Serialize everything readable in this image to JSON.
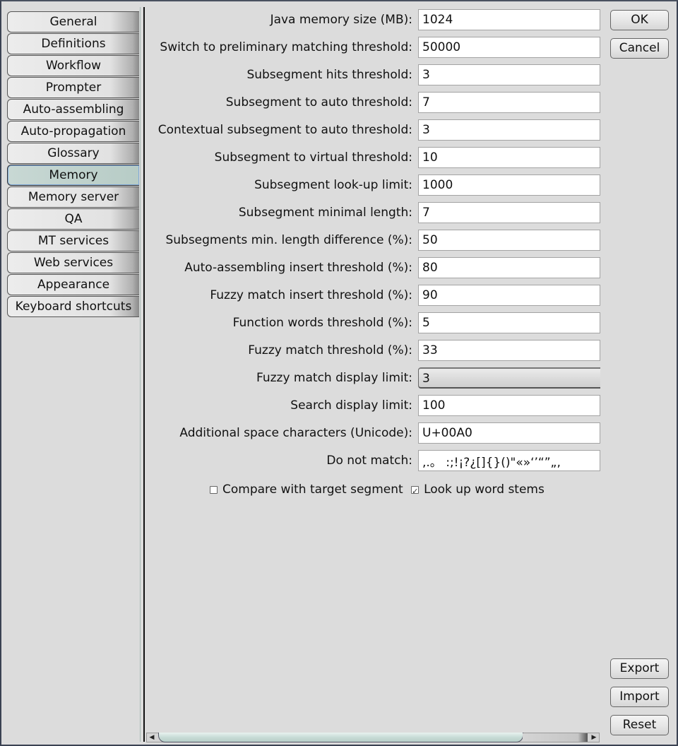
{
  "sidebar": {
    "items": [
      {
        "label": "General"
      },
      {
        "label": "Definitions"
      },
      {
        "label": "Workflow"
      },
      {
        "label": "Prompter"
      },
      {
        "label": "Auto-assembling"
      },
      {
        "label": "Auto-propagation"
      },
      {
        "label": "Glossary"
      },
      {
        "label": "Memory",
        "active": true
      },
      {
        "label": "Memory server"
      },
      {
        "label": "QA"
      },
      {
        "label": "MT services"
      },
      {
        "label": "Web services"
      },
      {
        "label": "Appearance"
      },
      {
        "label": "Keyboard shortcuts"
      }
    ],
    "selected": "Memory"
  },
  "form": {
    "fields": [
      {
        "label": "Java memory size (MB):",
        "value": "1024"
      },
      {
        "label": "Switch to preliminary matching threshold:",
        "value": "50000"
      },
      {
        "label": "Subsegment hits threshold:",
        "value": "3"
      },
      {
        "label": "Subsegment to auto threshold:",
        "value": "7"
      },
      {
        "label": "Contextual subsegment to auto threshold:",
        "value": "3"
      },
      {
        "label": "Subsegment to virtual threshold:",
        "value": "10"
      },
      {
        "label": "Subsegment look-up limit:",
        "value": "1000"
      },
      {
        "label": "Subsegment minimal length:",
        "value": "7"
      },
      {
        "label": "Subsegments min. length difference (%):",
        "value": "50"
      },
      {
        "label": "Auto-assembling insert threshold (%):",
        "value": "80"
      },
      {
        "label": "Fuzzy match insert threshold (%):",
        "value": "90"
      },
      {
        "label": "Function words threshold (%):",
        "value": "5"
      },
      {
        "label": "Fuzzy match threshold (%):",
        "value": "33"
      },
      {
        "label": "Fuzzy match display limit:",
        "value": "3",
        "type": "spinner"
      },
      {
        "label": "Search display limit:",
        "value": "100"
      },
      {
        "label": "Additional space characters (Unicode):",
        "value": "U+00A0"
      },
      {
        "label": "Do not match:",
        "value": ",.。 :;!¡?¿[]{}()\"«»‘’“”„‚"
      }
    ],
    "checkboxes": [
      {
        "label": "Compare with target segment",
        "checked": false
      },
      {
        "label": "Look up word stems",
        "checked": true
      }
    ]
  },
  "buttons": {
    "ok": "OK",
    "cancel": "Cancel",
    "export": "Export",
    "import": "Import",
    "reset": "Reset"
  },
  "scrollbar": {
    "left_arrow": "◀",
    "right_arrow": "▶"
  }
}
